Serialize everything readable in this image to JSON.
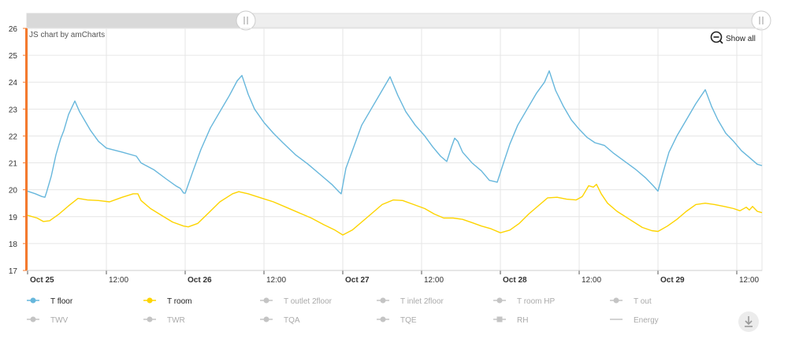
{
  "chart_data": {
    "type": "line",
    "watermark": "JS chart by amCharts",
    "show_all_label": "Show all",
    "y_ticks": [
      "17",
      "18",
      "19",
      "20",
      "21",
      "22",
      "23",
      "24",
      "25",
      "26"
    ],
    "ylim": [
      17,
      26
    ],
    "x_ticks": [
      {
        "label": "Oct 25",
        "day": 0.0,
        "bold": true
      },
      {
        "label": "12:00",
        "day": 0.5,
        "bold": false
      },
      {
        "label": "Oct 26",
        "day": 1.0,
        "bold": true
      },
      {
        "label": "12:00",
        "day": 1.5,
        "bold": false
      },
      {
        "label": "Oct 27",
        "day": 2.0,
        "bold": true
      },
      {
        "label": "12:00",
        "day": 2.5,
        "bold": false
      },
      {
        "label": "Oct 28",
        "day": 3.0,
        "bold": true
      },
      {
        "label": "12:00",
        "day": 3.5,
        "bold": false
      },
      {
        "label": "Oct 29",
        "day": 4.0,
        "bold": true
      },
      {
        "label": "12:00",
        "day": 4.5,
        "bold": false
      }
    ],
    "grid": true,
    "series": [
      {
        "name": "T floor",
        "color": "#67b7dc",
        "points": [
          [
            0.0,
            19.95
          ],
          [
            0.05,
            19.85
          ],
          [
            0.09,
            19.75
          ],
          [
            0.11,
            19.72
          ],
          [
            0.12,
            19.9
          ],
          [
            0.15,
            20.5
          ],
          [
            0.18,
            21.3
          ],
          [
            0.21,
            21.9
          ],
          [
            0.23,
            22.2
          ],
          [
            0.26,
            22.8
          ],
          [
            0.3,
            23.3
          ],
          [
            0.33,
            22.9
          ],
          [
            0.36,
            22.6
          ],
          [
            0.4,
            22.2
          ],
          [
            0.45,
            21.8
          ],
          [
            0.5,
            21.55
          ],
          [
            0.6,
            21.4
          ],
          [
            0.69,
            21.25
          ],
          [
            0.72,
            21.0
          ],
          [
            0.8,
            20.75
          ],
          [
            0.88,
            20.4
          ],
          [
            0.94,
            20.15
          ],
          [
            0.97,
            20.05
          ],
          [
            0.99,
            19.88
          ],
          [
            1.0,
            19.87
          ],
          [
            1.05,
            20.7
          ],
          [
            1.1,
            21.5
          ],
          [
            1.16,
            22.3
          ],
          [
            1.22,
            22.9
          ],
          [
            1.28,
            23.5
          ],
          [
            1.33,
            24.05
          ],
          [
            1.36,
            24.25
          ],
          [
            1.4,
            23.55
          ],
          [
            1.44,
            23.0
          ],
          [
            1.5,
            22.5
          ],
          [
            1.56,
            22.1
          ],
          [
            1.62,
            21.75
          ],
          [
            1.7,
            21.3
          ],
          [
            1.78,
            20.95
          ],
          [
            1.86,
            20.55
          ],
          [
            1.93,
            20.2
          ],
          [
            1.98,
            19.9
          ],
          [
            1.99,
            19.85
          ],
          [
            2.02,
            20.8
          ],
          [
            2.07,
            21.6
          ],
          [
            2.12,
            22.4
          ],
          [
            2.18,
            23.0
          ],
          [
            2.24,
            23.6
          ],
          [
            2.3,
            24.2
          ],
          [
            2.35,
            23.5
          ],
          [
            2.4,
            22.9
          ],
          [
            2.46,
            22.4
          ],
          [
            2.52,
            22.0
          ],
          [
            2.57,
            21.6
          ],
          [
            2.62,
            21.25
          ],
          [
            2.66,
            21.05
          ],
          [
            2.69,
            21.6
          ],
          [
            2.71,
            21.92
          ],
          [
            2.73,
            21.8
          ],
          [
            2.76,
            21.4
          ],
          [
            2.82,
            21.0
          ],
          [
            2.88,
            20.7
          ],
          [
            2.93,
            20.35
          ],
          [
            2.98,
            20.28
          ],
          [
            3.02,
            21.0
          ],
          [
            3.06,
            21.7
          ],
          [
            3.11,
            22.4
          ],
          [
            3.17,
            23.0
          ],
          [
            3.23,
            23.6
          ],
          [
            3.28,
            24.0
          ],
          [
            3.31,
            24.42
          ],
          [
            3.35,
            23.7
          ],
          [
            3.4,
            23.1
          ],
          [
            3.45,
            22.6
          ],
          [
            3.5,
            22.25
          ],
          [
            3.55,
            21.95
          ],
          [
            3.6,
            21.75
          ],
          [
            3.66,
            21.65
          ],
          [
            3.72,
            21.35
          ],
          [
            3.79,
            21.05
          ],
          [
            3.86,
            20.75
          ],
          [
            3.92,
            20.45
          ],
          [
            3.97,
            20.15
          ],
          [
            4.0,
            19.95
          ],
          [
            4.03,
            20.6
          ],
          [
            4.07,
            21.4
          ],
          [
            4.12,
            22.0
          ],
          [
            4.18,
            22.6
          ],
          [
            4.24,
            23.2
          ],
          [
            4.3,
            23.72
          ],
          [
            4.34,
            23.1
          ],
          [
            4.38,
            22.6
          ],
          [
            4.43,
            22.1
          ],
          [
            4.48,
            21.8
          ],
          [
            4.53,
            21.45
          ],
          [
            4.58,
            21.2
          ],
          [
            4.63,
            20.95
          ],
          [
            4.66,
            20.9
          ]
        ]
      },
      {
        "name": "T room",
        "color": "#fdd400",
        "points": [
          [
            0.0,
            19.05
          ],
          [
            0.06,
            18.95
          ],
          [
            0.1,
            18.82
          ],
          [
            0.14,
            18.85
          ],
          [
            0.2,
            19.1
          ],
          [
            0.26,
            19.4
          ],
          [
            0.32,
            19.68
          ],
          [
            0.38,
            19.62
          ],
          [
            0.45,
            19.6
          ],
          [
            0.52,
            19.55
          ],
          [
            0.6,
            19.72
          ],
          [
            0.67,
            19.85
          ],
          [
            0.7,
            19.85
          ],
          [
            0.72,
            19.6
          ],
          [
            0.78,
            19.3
          ],
          [
            0.85,
            19.05
          ],
          [
            0.92,
            18.8
          ],
          [
            0.99,
            18.65
          ],
          [
            1.02,
            18.62
          ],
          [
            1.08,
            18.75
          ],
          [
            1.15,
            19.15
          ],
          [
            1.22,
            19.55
          ],
          [
            1.3,
            19.85
          ],
          [
            1.34,
            19.93
          ],
          [
            1.4,
            19.85
          ],
          [
            1.48,
            19.7
          ],
          [
            1.56,
            19.55
          ],
          [
            1.64,
            19.35
          ],
          [
            1.72,
            19.15
          ],
          [
            1.8,
            18.95
          ],
          [
            1.88,
            18.7
          ],
          [
            1.95,
            18.5
          ],
          [
            2.0,
            18.32
          ],
          [
            2.06,
            18.5
          ],
          [
            2.12,
            18.8
          ],
          [
            2.18,
            19.1
          ],
          [
            2.25,
            19.45
          ],
          [
            2.32,
            19.62
          ],
          [
            2.38,
            19.6
          ],
          [
            2.45,
            19.45
          ],
          [
            2.52,
            19.3
          ],
          [
            2.58,
            19.1
          ],
          [
            2.64,
            18.95
          ],
          [
            2.7,
            18.95
          ],
          [
            2.76,
            18.9
          ],
          [
            2.82,
            18.78
          ],
          [
            2.88,
            18.65
          ],
          [
            2.94,
            18.55
          ],
          [
            3.0,
            18.4
          ],
          [
            3.06,
            18.5
          ],
          [
            3.12,
            18.75
          ],
          [
            3.18,
            19.1
          ],
          [
            3.24,
            19.4
          ],
          [
            3.3,
            19.7
          ],
          [
            3.36,
            19.72
          ],
          [
            3.42,
            19.65
          ],
          [
            3.48,
            19.62
          ],
          [
            3.52,
            19.75
          ],
          [
            3.56,
            20.15
          ],
          [
            3.59,
            20.1
          ],
          [
            3.61,
            20.2
          ],
          [
            3.64,
            19.85
          ],
          [
            3.68,
            19.5
          ],
          [
            3.74,
            19.2
          ],
          [
            3.82,
            18.9
          ],
          [
            3.9,
            18.6
          ],
          [
            3.96,
            18.48
          ],
          [
            4.0,
            18.45
          ],
          [
            4.06,
            18.65
          ],
          [
            4.12,
            18.9
          ],
          [
            4.18,
            19.2
          ],
          [
            4.24,
            19.45
          ],
          [
            4.3,
            19.5
          ],
          [
            4.36,
            19.45
          ],
          [
            4.42,
            19.38
          ],
          [
            4.48,
            19.3
          ],
          [
            4.52,
            19.22
          ],
          [
            4.56,
            19.35
          ],
          [
            4.58,
            19.25
          ],
          [
            4.6,
            19.38
          ],
          [
            4.63,
            19.2
          ],
          [
            4.66,
            19.15
          ]
        ]
      }
    ],
    "legend": [
      {
        "name": "T floor",
        "color": "#67b7dc",
        "active": true,
        "marker": "circle"
      },
      {
        "name": "T room",
        "color": "#fdd400",
        "active": true,
        "marker": "circle"
      },
      {
        "name": "T outlet 2floor",
        "color": "#c0c0c0",
        "active": false,
        "marker": "circle"
      },
      {
        "name": "T inlet 2floor",
        "color": "#c0c0c0",
        "active": false,
        "marker": "circle"
      },
      {
        "name": "T room HP",
        "color": "#c0c0c0",
        "active": false,
        "marker": "circle"
      },
      {
        "name": "T out",
        "color": "#c0c0c0",
        "active": false,
        "marker": "circle"
      },
      {
        "name": "TWV",
        "color": "#c0c0c0",
        "active": false,
        "marker": "circle"
      },
      {
        "name": "TWR",
        "color": "#c0c0c0",
        "active": false,
        "marker": "circle"
      },
      {
        "name": "TQA",
        "color": "#c0c0c0",
        "active": false,
        "marker": "circle"
      },
      {
        "name": "TQE",
        "color": "#c0c0c0",
        "active": false,
        "marker": "circle"
      },
      {
        "name": "RH",
        "color": "#c0c0c0",
        "active": false,
        "marker": "square"
      },
      {
        "name": "Energy",
        "color": "#c0c0c0",
        "active": false,
        "marker": "line"
      }
    ],
    "colors": {
      "axis_accent": "#f47a2e",
      "grid": "#e6e6e6",
      "text": "#333333",
      "muted": "#aaaaaa",
      "scrollbar": "#e8e8e8"
    }
  }
}
